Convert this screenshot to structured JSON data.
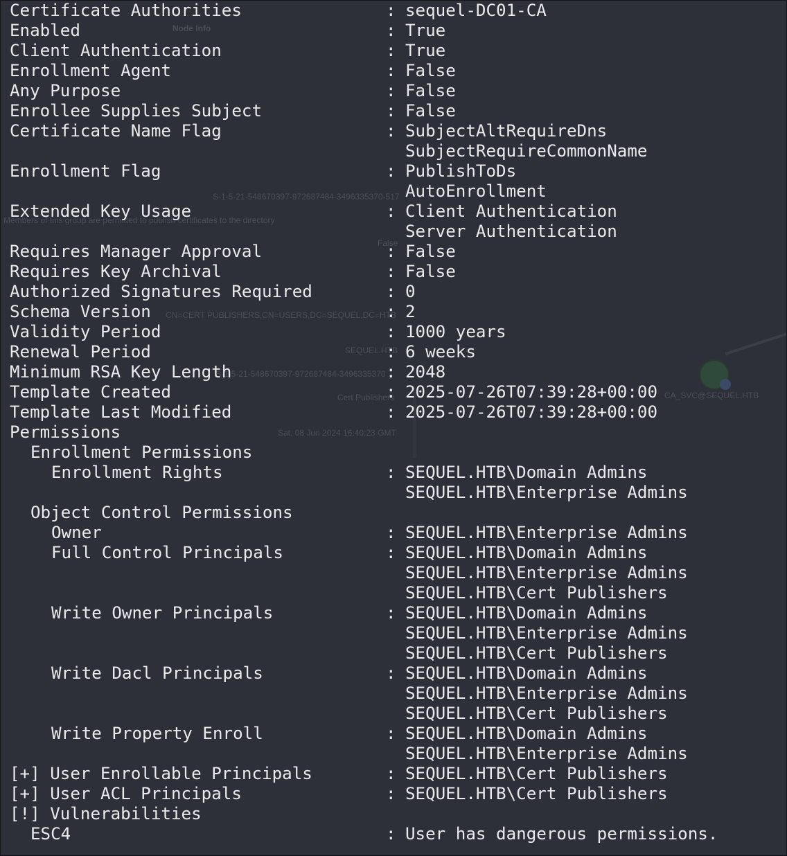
{
  "ghost_text": {
    "node_info": "Node Info",
    "sid": "S-1-5-21-548670397-972687484-3496335370-517",
    "description": "Members of this group are permitted to publish certificates to the directory",
    "false_value": "False",
    "dn": "CN=CERT PUBLISHERS,CN=USERS,DC=SEQUEL,DC=HTB",
    "domain": "SEQUEL.HTB",
    "sid2": "S-1-5-21-548670397-972687484-3496335370",
    "group_name": "Cert Publishers",
    "date": "Sat, 08 Jun 2024 16:40:23 GMT",
    "node_label": "CA_SVC@SEQUEL.HTB"
  },
  "rows": [
    {
      "indent": 0,
      "key": "Certificate Authorities",
      "sep": ":",
      "value": "sequel-DC01-CA"
    },
    {
      "indent": 0,
      "key": "Enabled",
      "sep": ":",
      "value": "True"
    },
    {
      "indent": 0,
      "key": "Client Authentication",
      "sep": ":",
      "value": "True"
    },
    {
      "indent": 0,
      "key": "Enrollment Agent",
      "sep": ":",
      "value": "False"
    },
    {
      "indent": 0,
      "key": "Any Purpose",
      "sep": ":",
      "value": "False"
    },
    {
      "indent": 0,
      "key": "Enrollee Supplies Subject",
      "sep": ":",
      "value": "False"
    },
    {
      "indent": 0,
      "key": "Certificate Name Flag",
      "sep": ":",
      "value": "SubjectAltRequireDns"
    },
    {
      "indent": 0,
      "key": "",
      "sep": "",
      "value": "SubjectRequireCommonName"
    },
    {
      "indent": 0,
      "key": "Enrollment Flag",
      "sep": ":",
      "value": "PublishToDs"
    },
    {
      "indent": 0,
      "key": "",
      "sep": "",
      "value": "AutoEnrollment"
    },
    {
      "indent": 0,
      "key": "Extended Key Usage",
      "sep": ":",
      "value": "Client Authentication"
    },
    {
      "indent": 0,
      "key": "",
      "sep": "",
      "value": "Server Authentication"
    },
    {
      "indent": 0,
      "key": "Requires Manager Approval",
      "sep": ":",
      "value": "False"
    },
    {
      "indent": 0,
      "key": "Requires Key Archival",
      "sep": ":",
      "value": "False"
    },
    {
      "indent": 0,
      "key": "Authorized Signatures Required",
      "sep": ":",
      "value": "0"
    },
    {
      "indent": 0,
      "key": "Schema Version",
      "sep": ":",
      "value": "2"
    },
    {
      "indent": 0,
      "key": "Validity Period",
      "sep": ":",
      "value": "1000 years"
    },
    {
      "indent": 0,
      "key": "Renewal Period",
      "sep": ":",
      "value": "6 weeks"
    },
    {
      "indent": 0,
      "key": "Minimum RSA Key Length",
      "sep": ":",
      "value": "2048"
    },
    {
      "indent": 0,
      "key": "Template Created",
      "sep": ":",
      "value": "2025-07-26T07:39:28+00:00"
    },
    {
      "indent": 0,
      "key": "Template Last Modified",
      "sep": ":",
      "value": "2025-07-26T07:39:28+00:00"
    },
    {
      "indent": 0,
      "key": "Permissions",
      "sep": "",
      "value": ""
    },
    {
      "indent": 2,
      "key": "Enrollment Permissions",
      "sep": "",
      "value": ""
    },
    {
      "indent": 4,
      "key": "Enrollment Rights",
      "sep": ":",
      "value": "SEQUEL.HTB\\Domain Admins"
    },
    {
      "indent": 0,
      "key": "",
      "sep": "",
      "value": "SEQUEL.HTB\\Enterprise Admins"
    },
    {
      "indent": 2,
      "key": "Object Control Permissions",
      "sep": "",
      "value": ""
    },
    {
      "indent": 4,
      "key": "Owner",
      "sep": ":",
      "value": "SEQUEL.HTB\\Enterprise Admins"
    },
    {
      "indent": 4,
      "key": "Full Control Principals",
      "sep": ":",
      "value": "SEQUEL.HTB\\Domain Admins"
    },
    {
      "indent": 0,
      "key": "",
      "sep": "",
      "value": "SEQUEL.HTB\\Enterprise Admins"
    },
    {
      "indent": 0,
      "key": "",
      "sep": "",
      "value": "SEQUEL.HTB\\Cert Publishers"
    },
    {
      "indent": 4,
      "key": "Write Owner Principals",
      "sep": ":",
      "value": "SEQUEL.HTB\\Domain Admins"
    },
    {
      "indent": 0,
      "key": "",
      "sep": "",
      "value": "SEQUEL.HTB\\Enterprise Admins"
    },
    {
      "indent": 0,
      "key": "",
      "sep": "",
      "value": "SEQUEL.HTB\\Cert Publishers"
    },
    {
      "indent": 4,
      "key": "Write Dacl Principals",
      "sep": ":",
      "value": "SEQUEL.HTB\\Domain Admins"
    },
    {
      "indent": 0,
      "key": "",
      "sep": "",
      "value": "SEQUEL.HTB\\Enterprise Admins"
    },
    {
      "indent": 0,
      "key": "",
      "sep": "",
      "value": "SEQUEL.HTB\\Cert Publishers"
    },
    {
      "indent": 4,
      "key": "Write Property Enroll",
      "sep": ":",
      "value": "SEQUEL.HTB\\Domain Admins"
    },
    {
      "indent": 0,
      "key": "",
      "sep": "",
      "value": "SEQUEL.HTB\\Enterprise Admins"
    },
    {
      "indent": 0,
      "key": "[+] User Enrollable Principals",
      "sep": ":",
      "value": "SEQUEL.HTB\\Cert Publishers"
    },
    {
      "indent": 0,
      "key": "[+] User ACL Principals",
      "sep": ":",
      "value": "SEQUEL.HTB\\Cert Publishers"
    },
    {
      "indent": 0,
      "key": "[!] Vulnerabilities",
      "sep": "",
      "value": ""
    },
    {
      "indent": 2,
      "key": "ESC4",
      "sep": ":",
      "value": "User has dangerous permissions."
    }
  ]
}
